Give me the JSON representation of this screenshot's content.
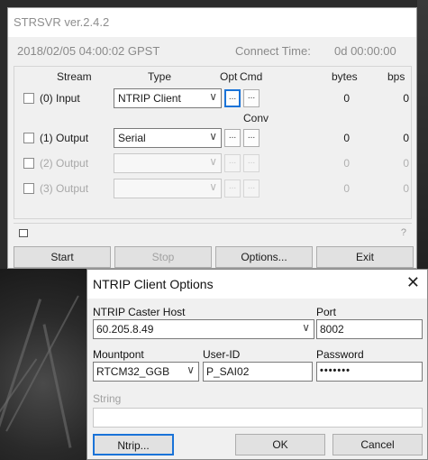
{
  "strsvr": {
    "title": "STRSVR ver.2.4.2",
    "status": {
      "datetime": "2018/02/05 04:00:02 GPST",
      "connect_label": "Connect Time:",
      "connect_value": "0d 00:00:00"
    },
    "headers": {
      "stream": "Stream",
      "type": "Type",
      "opt": "Opt",
      "cmd": "Cmd",
      "conv": "Conv",
      "bytes": "bytes",
      "bps": "bps"
    },
    "rows": [
      {
        "label": "(0) Input",
        "type": "NTRIP Client",
        "bytes": "0",
        "bps": "0",
        "enabled": true
      },
      {
        "label": "(1) Output",
        "type": "Serial",
        "bytes": "0",
        "bps": "0",
        "enabled": true
      },
      {
        "label": "(2) Output",
        "type": "",
        "bytes": "0",
        "bps": "0",
        "enabled": false
      },
      {
        "label": "(3) Output",
        "type": "",
        "bytes": "0",
        "bps": "0",
        "enabled": false
      }
    ],
    "dots_label": "...",
    "combo_arrow": "∨",
    "help_mark": "?",
    "buttons": {
      "start": "Start",
      "stop": "Stop",
      "options": "Options...",
      "exit": "Exit"
    }
  },
  "ntrip": {
    "title": "NTRIP Client Options",
    "close": "✕",
    "caster_host_label": "NTRIP Caster Host",
    "caster_host_value": "60.205.8.49",
    "port_label": "Port",
    "port_value": "8002",
    "mountpoint_label": "Mountpont",
    "mountpoint_value": "RTCM32_GGB",
    "userid_label": "User-ID",
    "userid_value": "P_SAI02",
    "password_label": "Password",
    "password_value": "•••••••",
    "string_label": "String",
    "string_value": "",
    "buttons": {
      "ntrip": "Ntrip...",
      "ok": "OK",
      "cancel": "Cancel"
    }
  }
}
